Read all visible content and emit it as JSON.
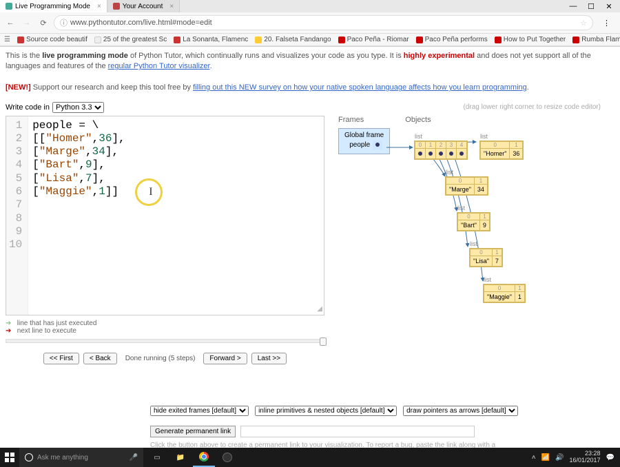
{
  "browser": {
    "tabs": [
      {
        "title": "Live Programming Mode",
        "active": true
      },
      {
        "title": "Your Account",
        "active": false
      }
    ],
    "url": "www.pythontutor.com/live.html#mode=edit",
    "bookmarks": [
      {
        "label": "Source code beautif",
        "color": "#c33"
      },
      {
        "label": "25 of the greatest Sc",
        "color": "#fff"
      },
      {
        "label": "La Sonanta, Flamenc",
        "color": "#c33"
      },
      {
        "label": "20. Falseta Fandango",
        "color": "#fc3"
      },
      {
        "label": "Paco Peña - Riomar",
        "color": "#c00"
      },
      {
        "label": "Paco Peña performs",
        "color": "#c00"
      },
      {
        "label": "How to Put Together",
        "color": "#c00"
      },
      {
        "label": "Rumba Flamenca: Ba",
        "color": "#c00"
      }
    ]
  },
  "intro": {
    "text1": "This is the ",
    "lpm": "live programming mode",
    "text2": " of Python Tutor, which continually runs and visualizes your code as you type. It is ",
    "he": "highly experimental",
    "text3": " and does not yet support all of the languages and features of the ",
    "link1": "regular Python Tutor visualizer",
    "new_label": "[NEW!]",
    "text4": " Support our research and keep this tool free by ",
    "link2": "filling out this NEW survey on how your native spoken language affects how you learn programming",
    "period": "."
  },
  "editor": {
    "label": "Write code in",
    "language": "Python 3.3",
    "drag_hint": "(drag lower right corner to resize code editor)"
  },
  "code": {
    "lines": [
      {
        "n": "1",
        "raw": "people = \\"
      },
      {
        "n": "2",
        "raw": "[[\"Homer\",36],"
      },
      {
        "n": "3",
        "raw": "[\"Marge\",34],"
      },
      {
        "n": "4",
        "raw": "[\"Bart\",9],"
      },
      {
        "n": "5",
        "raw": "[\"Lisa\",7],"
      },
      {
        "n": "6",
        "raw": "[\"Maggie\",1]]"
      },
      {
        "n": "7",
        "raw": ""
      },
      {
        "n": "8",
        "raw": ""
      },
      {
        "n": "9",
        "raw": ""
      },
      {
        "n": "10",
        "raw": ""
      }
    ]
  },
  "legend": {
    "just": "line that has just executed",
    "next": "next line to execute"
  },
  "controls": {
    "first": "<< First",
    "back": "< Back",
    "status": "Done running (5 steps)",
    "forward": "Forward >",
    "last": "Last >>"
  },
  "viz": {
    "frames_hdr": "Frames",
    "objects_hdr": "Objects",
    "global_frame": "Global frame",
    "var_people": "people",
    "list_label": "list",
    "people_indices": [
      "0",
      "1",
      "2",
      "3",
      "4"
    ],
    "rows": [
      {
        "name": "\"Homer\"",
        "val": "36"
      },
      {
        "name": "\"Marge\"",
        "val": "34"
      },
      {
        "name": "\"Bart\"",
        "val": "9"
      },
      {
        "name": "\"Lisa\"",
        "val": "7"
      },
      {
        "name": "\"Maggie\"",
        "val": "1"
      }
    ],
    "idx01": [
      "0",
      "1"
    ]
  },
  "options": {
    "opt1": "hide exited frames [default]",
    "opt2": "inline primitives & nested objects [default]",
    "opt3": "draw pointers as arrows [default]",
    "gen_link": "Generate permanent link",
    "footer": "Click the button above to create a permanent link to your visualization. To report a bug, paste the link along with a"
  },
  "taskbar": {
    "search_placeholder": "Ask me anything",
    "time": "23:28",
    "date": "16/01/2017"
  },
  "win": {
    "min": "—",
    "max": "☐",
    "close": "✕"
  }
}
